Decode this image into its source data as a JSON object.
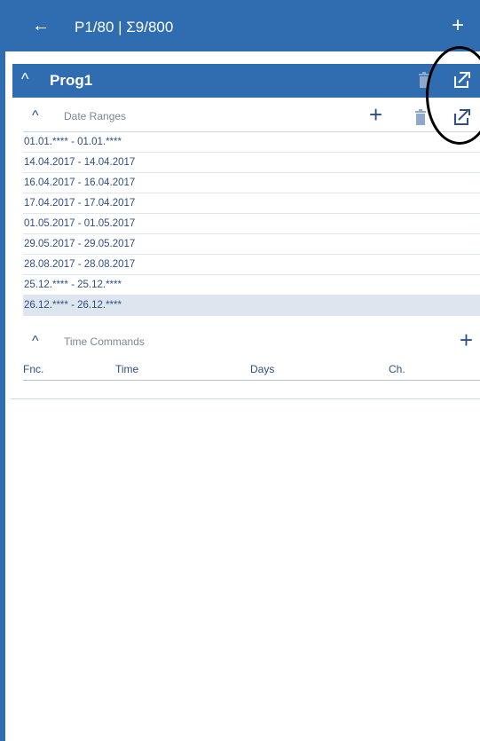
{
  "appbar": {
    "back_icon": "←",
    "title": "P1/80 | Σ9/800",
    "add_icon": "+"
  },
  "program": {
    "chevron": "^",
    "name": "Prog1"
  },
  "date_ranges": {
    "label": "Date Ranges",
    "add_icon": "+",
    "items": [
      "01.01.**** - 01.01.****",
      "14.04.2017 - 14.04.2017",
      "16.04.2017 - 16.04.2017",
      "17.04.2017 - 17.04.2017",
      "01.05.2017 - 01.05.2017",
      "29.05.2017 - 29.05.2017",
      "28.08.2017 - 28.08.2017",
      "25.12.**** - 25.12.****",
      "26.12.**** - 26.12.****"
    ]
  },
  "time_commands": {
    "label": "Time Commands",
    "add_icon": "+",
    "columns": [
      "Fnc.",
      "Time",
      "Days",
      "Ch."
    ]
  },
  "colors": {
    "brand": "#2f6db0",
    "text": "#2f4f82",
    "selected_row": "#dde5ef"
  }
}
